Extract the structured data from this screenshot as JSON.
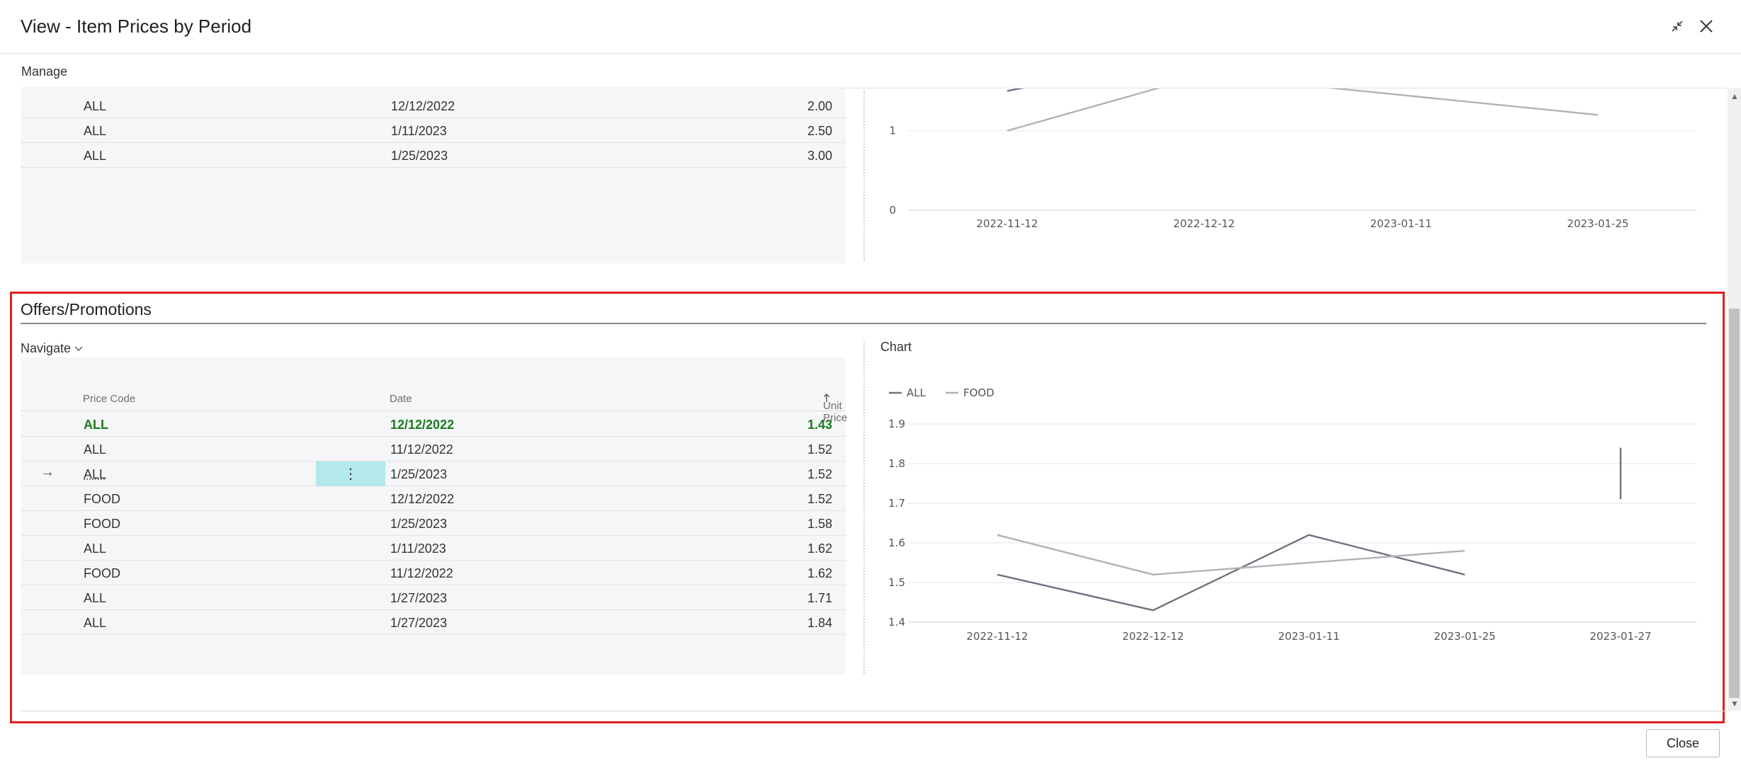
{
  "window": {
    "title": "View - Item Prices by Period"
  },
  "toolbar": {
    "manage_label": "Manage"
  },
  "upper_table": {
    "rows": [
      {
        "code": "ALL",
        "date": "12/12/2022",
        "price": "2.00"
      },
      {
        "code": "ALL",
        "date": "1/11/2023",
        "price": "2.50"
      },
      {
        "code": "ALL",
        "date": "1/25/2023",
        "price": "3.00"
      }
    ]
  },
  "offers": {
    "title": "Offers/Promotions",
    "navigate_label": "Navigate",
    "chart_label": "Chart",
    "columns": {
      "price_code": "Price Code",
      "date": "Date",
      "unit_price": "Unit Price"
    },
    "sort_icon": "arrow-up-icon",
    "rows": [
      {
        "code": "ALL",
        "date": "12/12/2022",
        "price": "1.43"
      },
      {
        "code": "ALL",
        "date": "11/12/2022",
        "price": "1.52"
      },
      {
        "code": "ALL",
        "date": "1/25/2023",
        "price": "1.52"
      },
      {
        "code": "FOOD",
        "date": "12/12/2022",
        "price": "1.52"
      },
      {
        "code": "FOOD",
        "date": "1/25/2023",
        "price": "1.58"
      },
      {
        "code": "ALL",
        "date": "1/11/2023",
        "price": "1.62"
      },
      {
        "code": "FOOD",
        "date": "11/12/2022",
        "price": "1.62"
      },
      {
        "code": "ALL",
        "date": "1/27/2023",
        "price": "1.71"
      },
      {
        "code": "ALL",
        "date": "1/27/2023",
        "price": "1.84"
      }
    ]
  },
  "footer": {
    "close_label": "Close"
  },
  "colors": {
    "accent_selected_text": "#1b7a1b",
    "row_menu_highlight": "#b3e8ec",
    "highlight_border": "#e02020",
    "series_all": "#6b7480",
    "series_food": "#b2b2b6"
  },
  "chart_data": [
    {
      "type": "line",
      "x": [
        "2022-11-12",
        "2022-12-12",
        "2023-01-11",
        "2023-01-25"
      ],
      "ylim": [
        0,
        2.2
      ],
      "yticks": [
        "0",
        "1",
        "2"
      ],
      "grid": true,
      "series": [
        {
          "name": "ALL",
          "color": "#6b7480",
          "values": [
            1.5,
            2.0,
            2.5,
            null
          ]
        },
        {
          "name": "FOOD",
          "color": "#b2b2b6",
          "values": [
            1.0,
            1.7,
            null,
            1.2
          ]
        }
      ]
    },
    {
      "type": "line",
      "x": [
        "2022-11-12",
        "2022-12-12",
        "2023-01-11",
        "2023-01-25",
        "2023-01-27"
      ],
      "ylim": [
        1.4,
        1.9
      ],
      "yticks": [
        "1.4",
        "1.5",
        "1.6",
        "1.7",
        "1.8",
        "1.9"
      ],
      "grid": true,
      "legend": "top-left",
      "series": [
        {
          "name": "ALL",
          "color": "#6b7480",
          "values": [
            1.52,
            1.43,
            1.62,
            1.52,
            null
          ],
          "range_last": [
            1.71,
            1.84
          ]
        },
        {
          "name": "FOOD",
          "color": "#b2b2b6",
          "values": [
            1.62,
            1.52,
            null,
            1.58,
            null
          ]
        }
      ]
    }
  ]
}
